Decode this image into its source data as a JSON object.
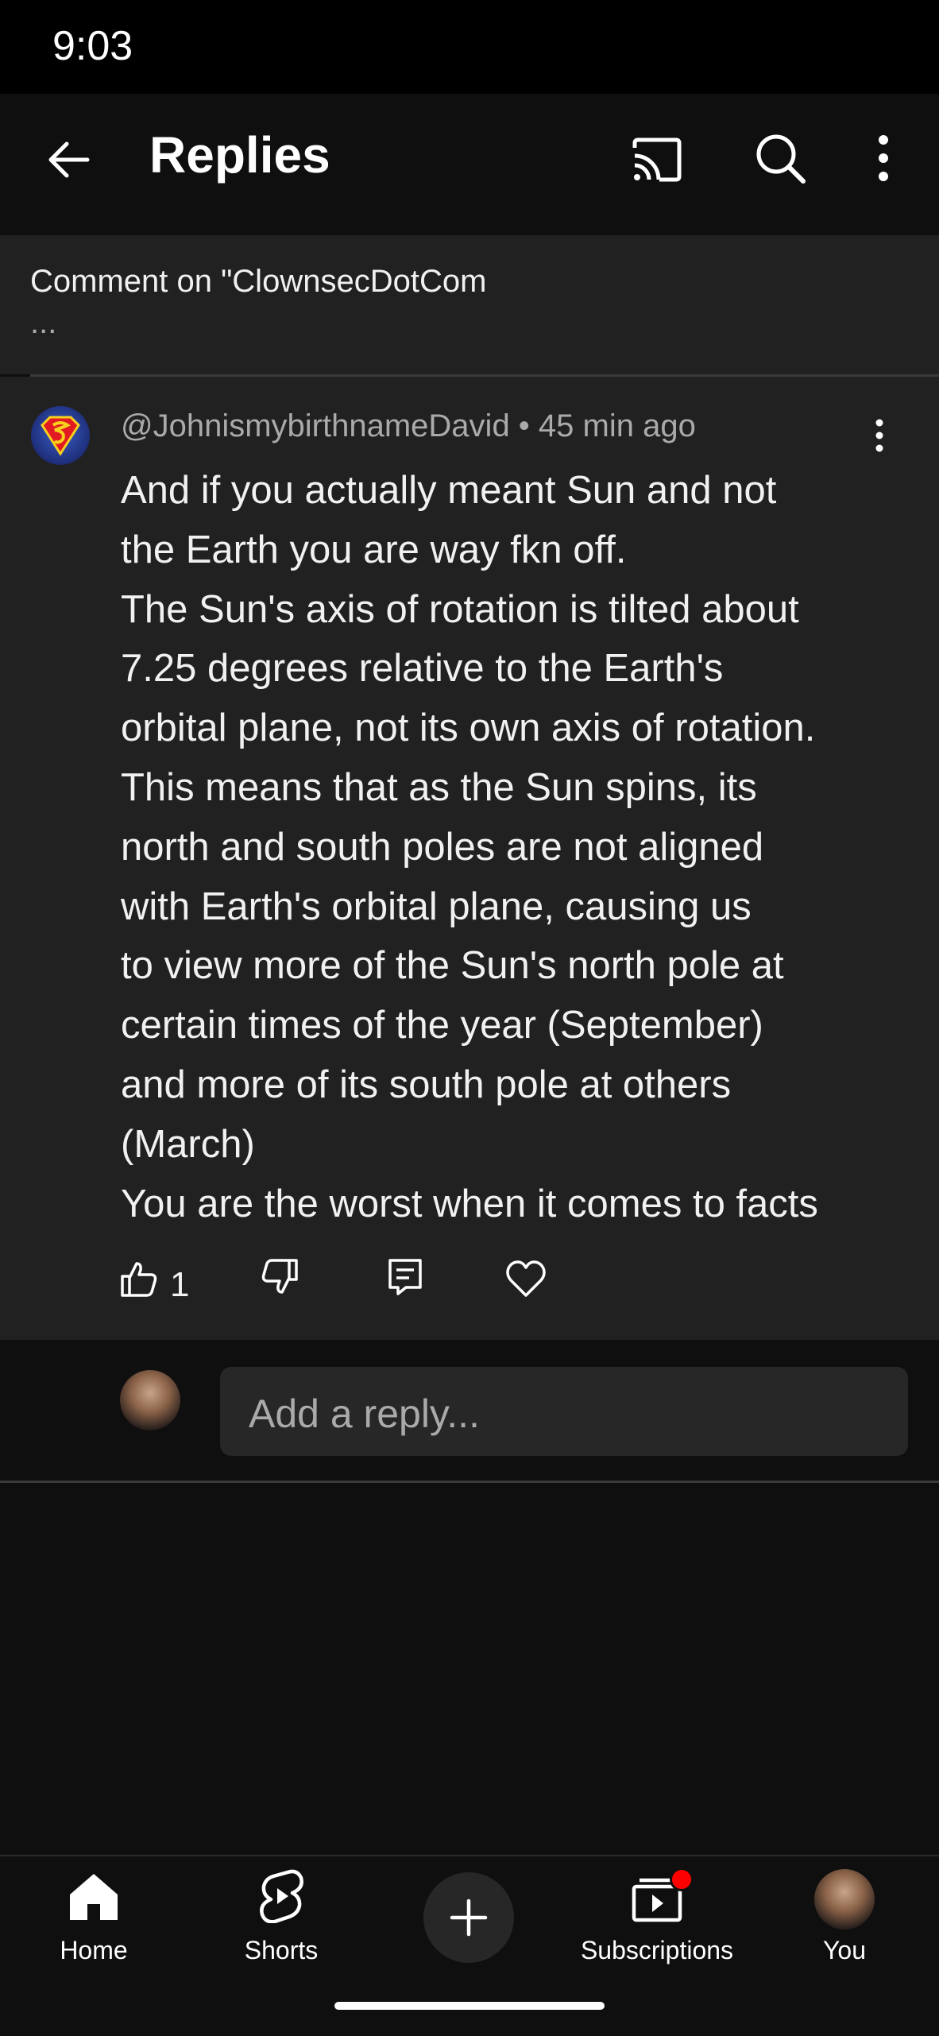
{
  "status_bar": {
    "time": "9:03"
  },
  "app_bar": {
    "title": "Replies"
  },
  "context": {
    "line1": "Comment on \"ClownsecDotCom",
    "line2": "..."
  },
  "comment": {
    "author": "@JohnismybirthnameDavid",
    "separator": " • ",
    "time_ago": "45 min ago",
    "body_lines": [
      "And if you actually meant Sun and not",
      "the Earth you are way fkn off.",
      "The Sun's axis of rotation is tilted about",
      "7.25 degrees relative to the Earth's",
      "orbital plane, not its own axis of rotation.",
      "This means that as the Sun spins, its",
      "north and south poles are not aligned",
      "with Earth's orbital plane, causing us",
      "to view more of the Sun's north pole at",
      "certain times of the year (September)",
      "and more of its south pole at others",
      "(March)",
      "You are the worst when it comes to facts"
    ],
    "like_count": "1"
  },
  "reply": {
    "placeholder": "Add a reply..."
  },
  "bottom_nav": {
    "home": "Home",
    "shorts": "Shorts",
    "subscriptions": "Subscriptions",
    "you": "You"
  },
  "colors": {
    "background": "#0f0f0f",
    "surface": "#212121",
    "notification_dot": "#ff0000"
  }
}
